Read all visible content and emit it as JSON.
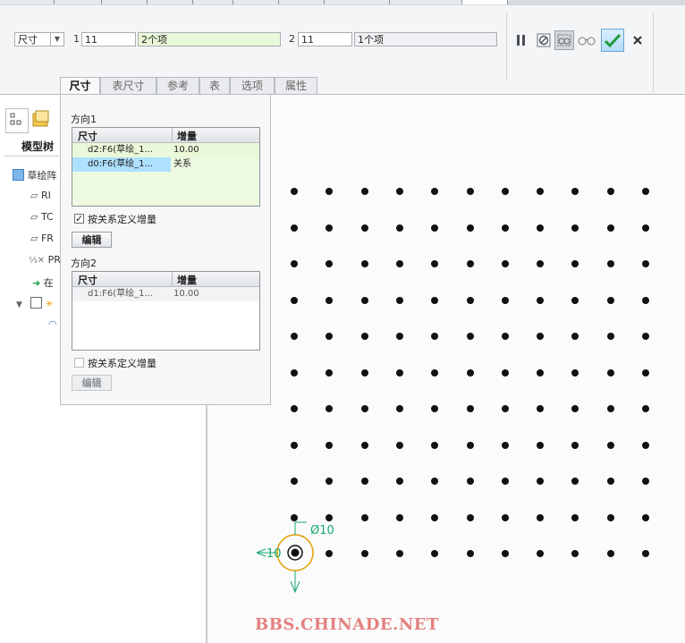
{
  "dashboard": {
    "type_value": "尺寸",
    "dir1_label": "1",
    "dir1_count": "11",
    "dir1_items": "2个项",
    "dir2_label": "2",
    "dir2_count": "11",
    "dir2_items": "1个项"
  },
  "tabs": [
    {
      "label": "尺寸",
      "active": true
    },
    {
      "label": "表尺寸",
      "active": false
    },
    {
      "label": "参考",
      "active": false
    },
    {
      "label": "表",
      "active": false
    },
    {
      "label": "选项",
      "active": false
    },
    {
      "label": "属性",
      "active": false
    }
  ],
  "panel": {
    "dir1": {
      "title": "方向1",
      "col_dim": "尺寸",
      "col_inc": "增量",
      "rows": [
        {
          "dim": "d2:F6(草绘_1...",
          "inc": "10.00"
        },
        {
          "dim": "d0:F6(草绘_1...",
          "inc": "关系"
        }
      ],
      "relation_checkbox": "按关系定义增量",
      "relation_checked": true,
      "edit_label": "编辑"
    },
    "dir2": {
      "title": "方向2",
      "col_dim": "尺寸",
      "col_inc": "增量",
      "rows": [
        {
          "dim": "d1:F6(草绘_1...",
          "inc": "10.00"
        }
      ],
      "relation_checkbox": "按关系定义增量",
      "relation_checked": false,
      "edit_label": "编辑"
    }
  },
  "tree": {
    "tab_label": "模型树",
    "items": [
      "草绘阵",
      "RI",
      "TC",
      "FR",
      "PR",
      "在"
    ]
  },
  "graphics": {
    "dim_diameter": "Ø10",
    "dim_left": "10",
    "watermark": "BBS.CHINADE.NET"
  },
  "colors": {
    "accent_green": "#19a86e",
    "selection": "#aee0ff",
    "dim_row_bg": "#eaf7d8"
  }
}
